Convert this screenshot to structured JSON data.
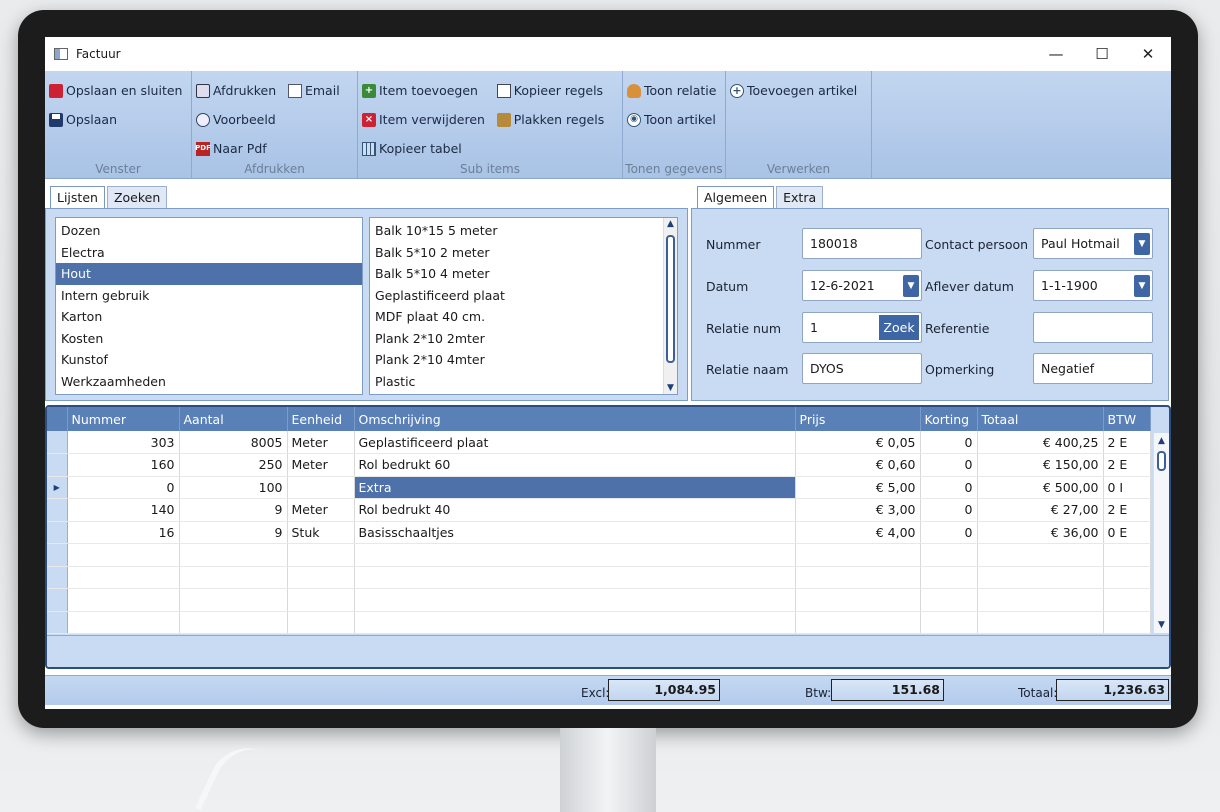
{
  "window": {
    "title": "Factuur",
    "controls": {
      "minimize": "—",
      "maximize": "☐",
      "close": "✕"
    }
  },
  "ribbon": {
    "groups": [
      {
        "label": "Venster",
        "buttons": [
          "Opslaan en sluiten",
          "Opslaan"
        ]
      },
      {
        "label": "Afdrukken",
        "buttons": [
          "Afdrukken",
          "Email",
          "Voorbeeld",
          "Naar Pdf"
        ]
      },
      {
        "label": "Sub items",
        "buttons": [
          "Item toevoegen",
          "Kopieer regels",
          "Item verwijderen",
          "Plakken regels",
          "Kopieer tabel"
        ]
      },
      {
        "label": "Tonen gegevens",
        "buttons": [
          "Toon relatie",
          "Toon artikel"
        ]
      },
      {
        "label": "Verwerken",
        "buttons": [
          "Toevoegen artikel"
        ]
      }
    ]
  },
  "left_tabs": [
    "Lijsten",
    "Zoeken"
  ],
  "categories": {
    "items": [
      "Dozen",
      "Electra",
      "Hout",
      "Intern gebruik",
      "Karton",
      "Kosten",
      "Kunstof",
      "Werkzaamheden"
    ],
    "selected": "Hout"
  },
  "articles": {
    "items": [
      "Balk 10*15 5 meter",
      "Balk 5*10 2 meter",
      "Balk 5*10 4 meter",
      "Geplastificeerd plaat",
      "MDF plaat 40 cm.",
      "Plank 2*10 2mter",
      "Plank 2*10 4mter",
      "Plastic"
    ]
  },
  "right_tabs": [
    "Algemeen",
    "Extra"
  ],
  "form": {
    "nummer_label": "Nummer",
    "nummer": "180018",
    "datum_label": "Datum",
    "datum": "12-6-2021",
    "relatie_num_label": "Relatie num",
    "relatie_num": "1",
    "zoek": "Zoek",
    "relatie_naam_label": "Relatie naam",
    "relatie_naam": "DYOS",
    "contact_label": "Contact persoon",
    "contact": "Paul Hotmail",
    "aflever_label": "Aflever datum",
    "aflever": "1-1-1900",
    "referentie_label": "Referentie",
    "referentie": "",
    "opmerking_label": "Opmerking",
    "opmerking": "Negatief"
  },
  "grid": {
    "columns": [
      "Nummer",
      "Aantal",
      "Eenheid",
      "Omschrijving",
      "Prijs",
      "Korting",
      "Totaal",
      "BTW"
    ],
    "rows": [
      {
        "nummer": "303",
        "aantal": "8005",
        "eenheid": "Meter",
        "omschrijving": "Geplastificeerd plaat",
        "prijs": "€ 0,05",
        "korting": "0",
        "totaal": "€ 400,25",
        "btw": "2 E"
      },
      {
        "nummer": "160",
        "aantal": "250",
        "eenheid": "Meter",
        "omschrijving": "Rol bedrukt 60",
        "prijs": "€ 0,60",
        "korting": "0",
        "totaal": "€ 150,00",
        "btw": "2 E"
      },
      {
        "nummer": "0",
        "aantal": "100",
        "eenheid": "",
        "omschrijving": "Extra",
        "prijs": "€ 5,00",
        "korting": "0",
        "totaal": "€ 500,00",
        "btw": "0 I"
      },
      {
        "nummer": "140",
        "aantal": "9",
        "eenheid": "Meter",
        "omschrijving": "Rol bedrukt 40",
        "prijs": "€ 3,00",
        "korting": "0",
        "totaal": "€ 27,00",
        "btw": "2 E"
      },
      {
        "nummer": "16",
        "aantal": "9",
        "eenheid": "Stuk",
        "omschrijving": "Basisschaaltjes",
        "prijs": "€ 4,00",
        "korting": "0",
        "totaal": "€ 36,00",
        "btw": "0 E"
      }
    ],
    "current_row_index": 2
  },
  "totals": {
    "excl_label": "Excl:",
    "excl": "1,084.95",
    "btw_label": "Btw:",
    "btw": "151.68",
    "totaal_label": "Totaal:",
    "totaal": "1,236.63"
  },
  "colors": {
    "ribbon": "#b8cfee",
    "selection": "#4d71a8",
    "header": "#5a80b8",
    "panel": "#c9dbf2"
  }
}
